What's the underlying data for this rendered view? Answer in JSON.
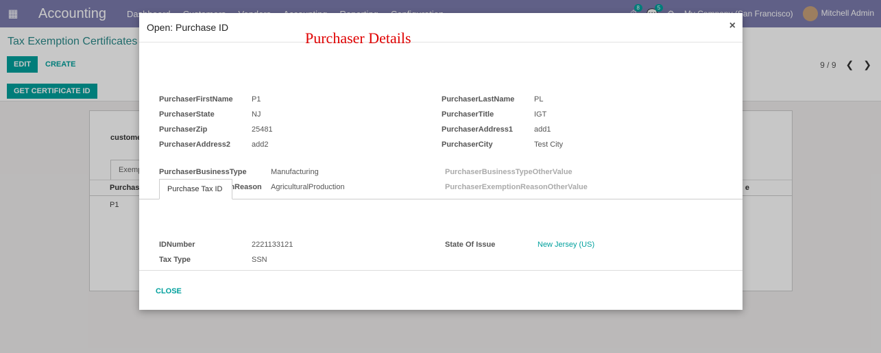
{
  "navbar": {
    "app_name": "Accounting",
    "menu": [
      "Dashboard",
      "Customers",
      "Vendors",
      "Accounting",
      "Reporting",
      "Configuration"
    ],
    "activity_count": "8",
    "message_count": "5",
    "company": "My Company (San Francisco)",
    "user": "Mitchell Admin"
  },
  "control_panel": {
    "title": "Tax Exemption Certificates",
    "edit_label": "EDIT",
    "create_label": "CREATE",
    "get_cert_label": "GET CERTIFICATE ID",
    "pager": "9 / 9"
  },
  "sheet": {
    "customer_label": "custome",
    "tab_label": "Exemp",
    "column_header": "Purchas",
    "column_header_right": "e",
    "row_value": "P1"
  },
  "modal": {
    "title": "Open: Purchase ID",
    "annotation": "Purchaser Details",
    "fields_left": [
      {
        "label": "PurchaserFirstName",
        "value": "P1"
      },
      {
        "label": "PurchaserState",
        "value": "NJ"
      },
      {
        "label": "PurchaserZip",
        "value": "25481"
      },
      {
        "label": "PurchaserAddress2",
        "value": "add2"
      }
    ],
    "fields_right": [
      {
        "label": "PurchaserLastName",
        "value": "PL"
      },
      {
        "label": "PurchaserTitle",
        "value": "IGT"
      },
      {
        "label": "PurchaserAddress1",
        "value": "add1"
      },
      {
        "label": "PurchaserCity",
        "value": "Test City"
      }
    ],
    "business_type_label": "PurchaserBusinessType",
    "business_type_value": "Manufacturing",
    "exemption_reason_label": "PurchaserExemptionReason",
    "exemption_reason_value": "AgriculturalProduction",
    "business_type_other_label": "PurchaserBusinessTypeOtherValue",
    "exemption_reason_other_label": "PurchaserExemptionReasonOtherValue",
    "tab_label": "Purchase Tax ID",
    "tax": {
      "id_number_label": "IDNumber",
      "id_number_value": "2221133121",
      "tax_type_label": "Tax Type",
      "tax_type_value": "SSN",
      "state_label": "State Of Issue",
      "state_value": "New Jersey (US)"
    },
    "close_label": "CLOSE"
  }
}
